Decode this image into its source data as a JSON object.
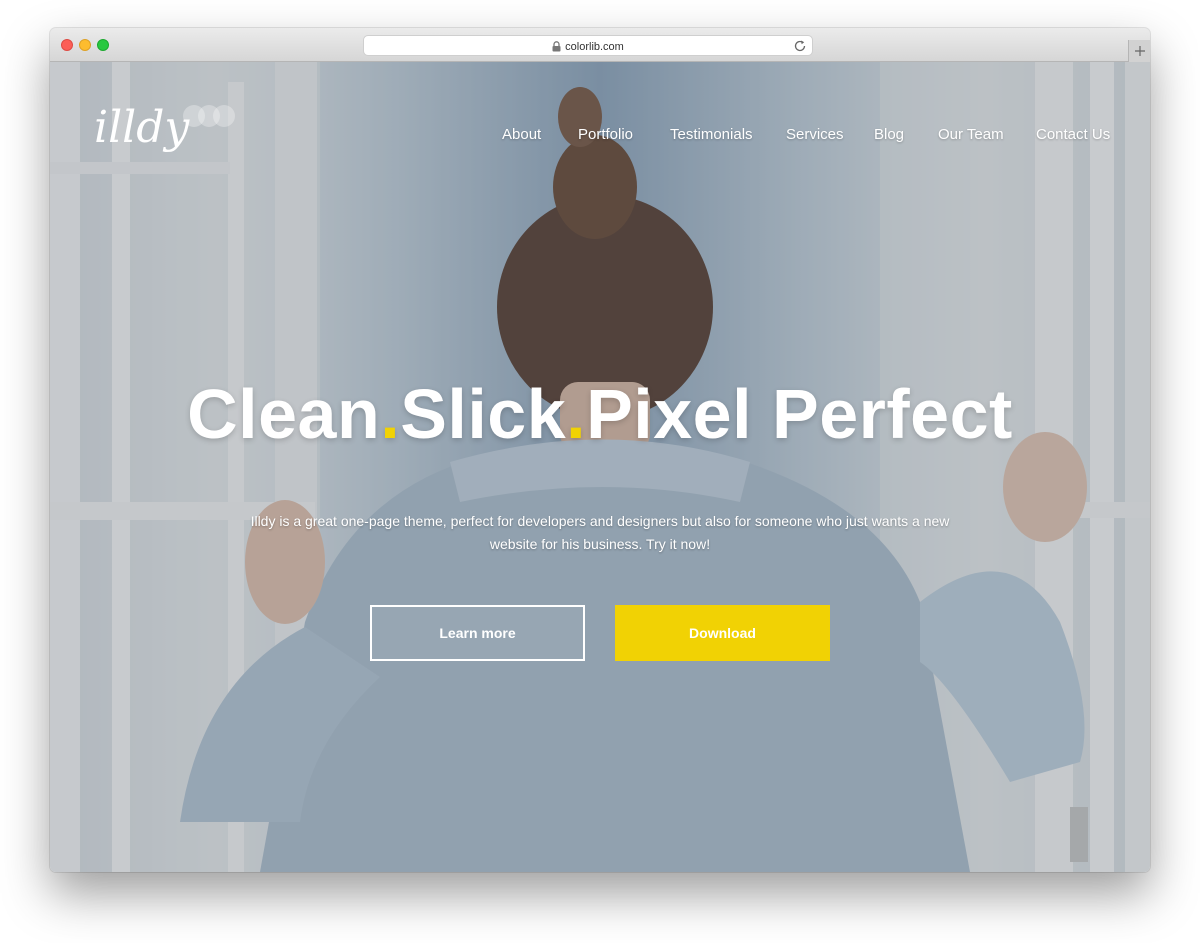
{
  "browser": {
    "url": "colorlib.com",
    "icons": {
      "lock": "lock-icon",
      "reload": "reload-icon",
      "new_tab": "plus-icon"
    }
  },
  "site": {
    "logo_text": "illdy",
    "nav": [
      "About",
      "Portfolio",
      "Testimonials",
      "Services",
      "Blog",
      "Our Team",
      "Contact Us"
    ]
  },
  "hero": {
    "title_parts": [
      "Clean",
      ".",
      "Slick",
      ".",
      "Pixel Perfect"
    ],
    "description": "Illdy is a great one-page theme, perfect for developers and designers but also for someone who just wants a new website for his business. Try it now!",
    "learn_more_label": "Learn more",
    "download_label": "Download"
  },
  "colors": {
    "accent": "#f1d204",
    "text": "#ffffff",
    "traffic_red": "#fc5f57",
    "traffic_yellow": "#fdbc2e",
    "traffic_green": "#28c840"
  }
}
